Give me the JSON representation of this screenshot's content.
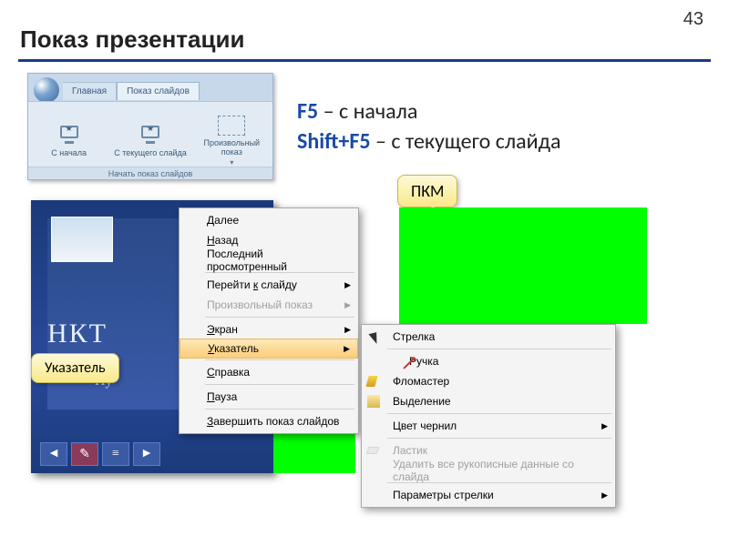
{
  "page_number": "43",
  "title": "Показ презентации",
  "ribbon": {
    "tabs": [
      "Главная",
      "Показ слайдов"
    ],
    "active_tab": 1,
    "buttons": [
      {
        "label": "С начала"
      },
      {
        "label": "С текущего слайда"
      },
      {
        "label": "Произвольный показ"
      }
    ],
    "dropdown_glyph": "▾",
    "group_label": "Начать показ слайдов"
  },
  "shortcuts": {
    "f5_key": "F5",
    "f5_text": " – с начала",
    "shift_f5_key": "Shift+F5",
    "shift_f5_text": " – с текущего слайда"
  },
  "callouts": {
    "pkm": "ПКМ",
    "ukazatel": "Указатель"
  },
  "slide": {
    "title_fragment": "НКТ",
    "subtitle_fragment": "Пу",
    "nav": {
      "prev": "◄",
      "next": "►",
      "pen": "✎",
      "menu": "≡"
    }
  },
  "context_main": [
    {
      "label": "Далее",
      "underline_first": true
    },
    {
      "label": "Назад",
      "underline_first": true
    },
    {
      "label": "Последний просмотренный"
    },
    {
      "sep": true
    },
    {
      "label": "Перейти к слайду",
      "sub": true,
      "underline_at": "к"
    },
    {
      "label": "Произвольный показ",
      "sub": true,
      "disabled": true
    },
    {
      "sep": true
    },
    {
      "label": "Экран",
      "sub": true,
      "underline_first": true
    },
    {
      "label": "Указатель",
      "sub": true,
      "selected": true,
      "underline_first": true
    },
    {
      "sep": true
    },
    {
      "label": "Справка",
      "underline_first": true
    },
    {
      "sep": true
    },
    {
      "label": "Пауза",
      "underline_first": true
    },
    {
      "sep": true
    },
    {
      "label": "Завершить показ слайдов",
      "underline_first": true
    }
  ],
  "context_sub": [
    {
      "label": "Стрелка",
      "icon": "cursor"
    },
    {
      "sep": true
    },
    {
      "label": "Ручка",
      "icon": "pen-ball"
    },
    {
      "label": "Фломастер",
      "icon": "marker"
    },
    {
      "label": "Выделение",
      "icon": "hl"
    },
    {
      "sep": true
    },
    {
      "label": "Цвет чернил",
      "sub": true
    },
    {
      "sep": true
    },
    {
      "label": "Ластик",
      "icon": "eraser",
      "disabled": true
    },
    {
      "label": "Удалить все рукописные данные со слайда",
      "disabled": true
    },
    {
      "sep": true
    },
    {
      "label": "Параметры стрелки",
      "sub": true
    }
  ]
}
